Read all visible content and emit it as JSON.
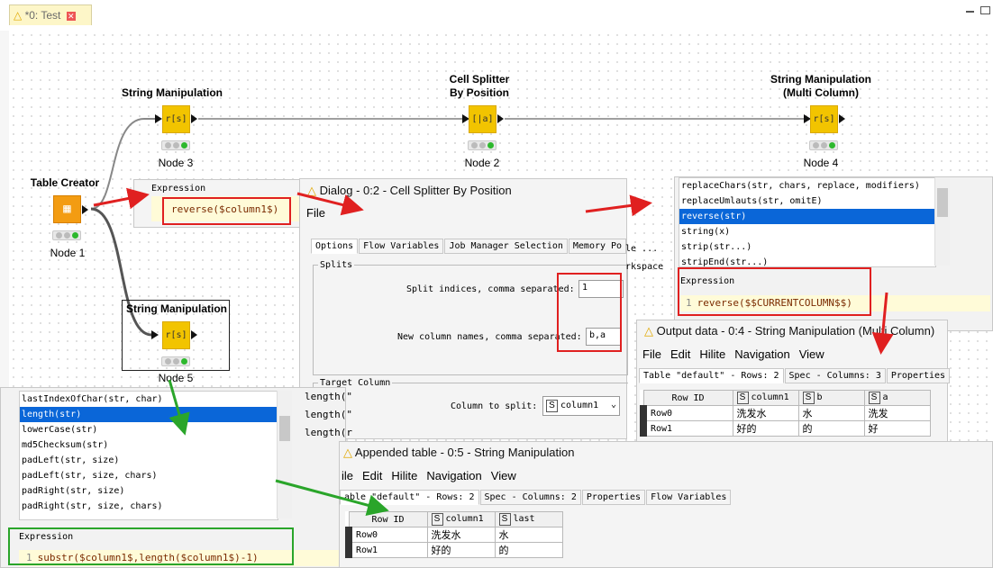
{
  "tab": {
    "title": "*0: Test"
  },
  "nodes": {
    "n1": {
      "label": "Table Creator",
      "caption": "Node 1",
      "icon": "table-creator-icon"
    },
    "n3": {
      "label": "String Manipulation",
      "caption": "Node 3",
      "glyph": "r[s]"
    },
    "n2": {
      "label_line1": "Cell Splitter",
      "label_line2": "By Position",
      "caption": "Node 2",
      "glyph": "[|a]"
    },
    "n4": {
      "label_line1": "String Manipulation",
      "label_line2": "(Multi Column)",
      "caption": "Node 4",
      "glyph": "r[s]"
    },
    "n5": {
      "label": "String Manipulation",
      "caption": "Node 5",
      "glyph": "r[s]"
    }
  },
  "expr_top": {
    "header": "Expression",
    "code": "reverse($column1$)"
  },
  "dialog": {
    "title": "Dialog - 0:2 - Cell Splitter By Position",
    "menu": "File",
    "tabs": [
      "Options",
      "Flow Variables",
      "Job Manager Selection",
      "Memory Po"
    ],
    "splits_group": "Splits",
    "split_indices_label": "Split indices, comma separated:",
    "split_indices_value": "1",
    "new_names_label": "New column names, comma separated:",
    "new_names_value": "b,a",
    "target_group": "Target Column",
    "column_label": "Column to split:",
    "column_value": "column1",
    "fragments": [
      "le ...",
      "rkspace"
    ]
  },
  "multi_panel": {
    "functions": [
      "replaceChars(str, chars, replace, modifiers)",
      "replaceUmlauts(str, omitE)",
      "reverse(str)",
      "string(x)",
      "strip(str...)",
      "stripEnd(str...)"
    ],
    "selected_index": 2,
    "expr_header": "Expression",
    "line_no": "1",
    "code": "reverse($$CURRENTCOLUMN$$)"
  },
  "output": {
    "title": "Output data - 0:4 - String Manipulation (Multi Column)",
    "menu": [
      "File",
      "Edit",
      "Hilite",
      "Navigation",
      "View"
    ],
    "tabs": [
      "Table \"default\" - Rows: 2",
      "Spec - Columns: 3",
      "Properties"
    ],
    "headers": [
      "Row ID",
      "column1",
      "b",
      "a"
    ],
    "rows": [
      [
        "Row0",
        "洗发水",
        "水",
        "洗发"
      ],
      [
        "Row1",
        "好的",
        "的",
        "好"
      ]
    ]
  },
  "appended": {
    "title": "Appended table - 0:5 - String Manipulation",
    "menu": [
      "ile",
      "Edit",
      "Hilite",
      "Navigation",
      "View"
    ],
    "tabs": [
      "able \"default\" - Rows: 2",
      "Spec - Columns: 2",
      "Properties",
      "Flow Variables"
    ],
    "headers": [
      "Row ID",
      "column1",
      "last"
    ],
    "rows": [
      [
        "Row0",
        "洗发水",
        "水"
      ],
      [
        "Row1",
        "好的",
        "的"
      ]
    ]
  },
  "left_panel": {
    "functions": [
      "lastIndexOfChar(str, char)",
      "length(str)",
      "lowerCase(str)",
      "md5Checksum(str)",
      "padLeft(str, size)",
      "padLeft(str, size, chars)",
      "padRight(str, size)",
      "padRight(str, size, chars)"
    ],
    "selected_index": 1,
    "expr_header": "Expression",
    "line_no": "1",
    "code": "substr($column1$,length($column1$)-1)",
    "side_lines": [
      "length(\"",
      "length(\"",
      "length(r"
    ]
  },
  "colors": {
    "node_yellow": "#f2c400",
    "node_orange": "#f39c12",
    "highlight_red": "#e02020",
    "highlight_green": "#2aa52a",
    "selection_blue": "#0a66d8"
  }
}
